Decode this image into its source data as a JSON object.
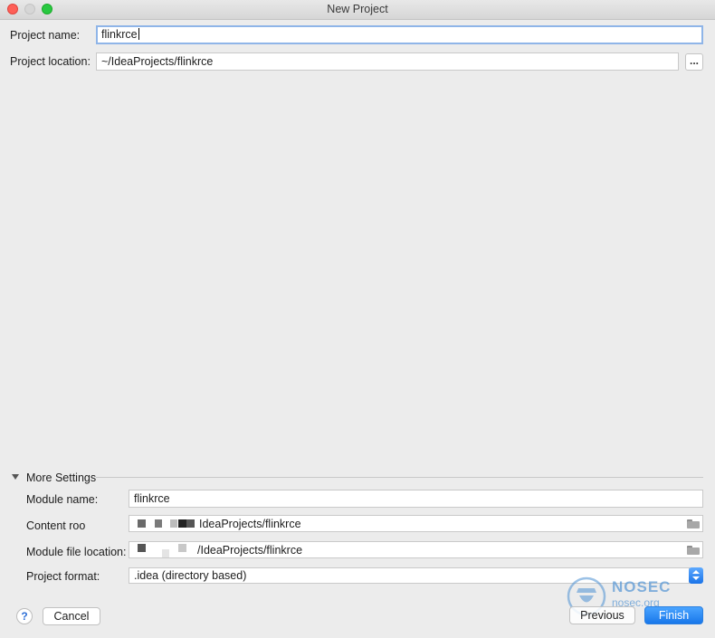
{
  "window": {
    "title": "New Project"
  },
  "project": {
    "name_label": "Project name:",
    "name_value": "flinkrce",
    "location_label": "Project location:",
    "location_value": "~/IdeaProjects/flinkrce",
    "browse_label": "..."
  },
  "more_settings": {
    "section_title": "More Settings",
    "module_name_label": "Module name:",
    "module_name_value": "flinkrce",
    "content_root_label": "Content roo",
    "content_root_value": "IdeaProjects/flinkrce",
    "module_file_label": "Module file location:",
    "module_file_value": "/IdeaProjects/flinkrce",
    "format_label": "Project format:",
    "format_value": ".idea (directory based)"
  },
  "footer": {
    "help_label": "?",
    "cancel_label": "Cancel",
    "previous_label": "Previous",
    "finish_label": "Finish"
  },
  "watermark": {
    "brand": "NOSEC",
    "site": "nosec.org"
  },
  "colors": {
    "accent": "#1877ea",
    "focus": "#8fb5e8",
    "background": "#ececec"
  }
}
